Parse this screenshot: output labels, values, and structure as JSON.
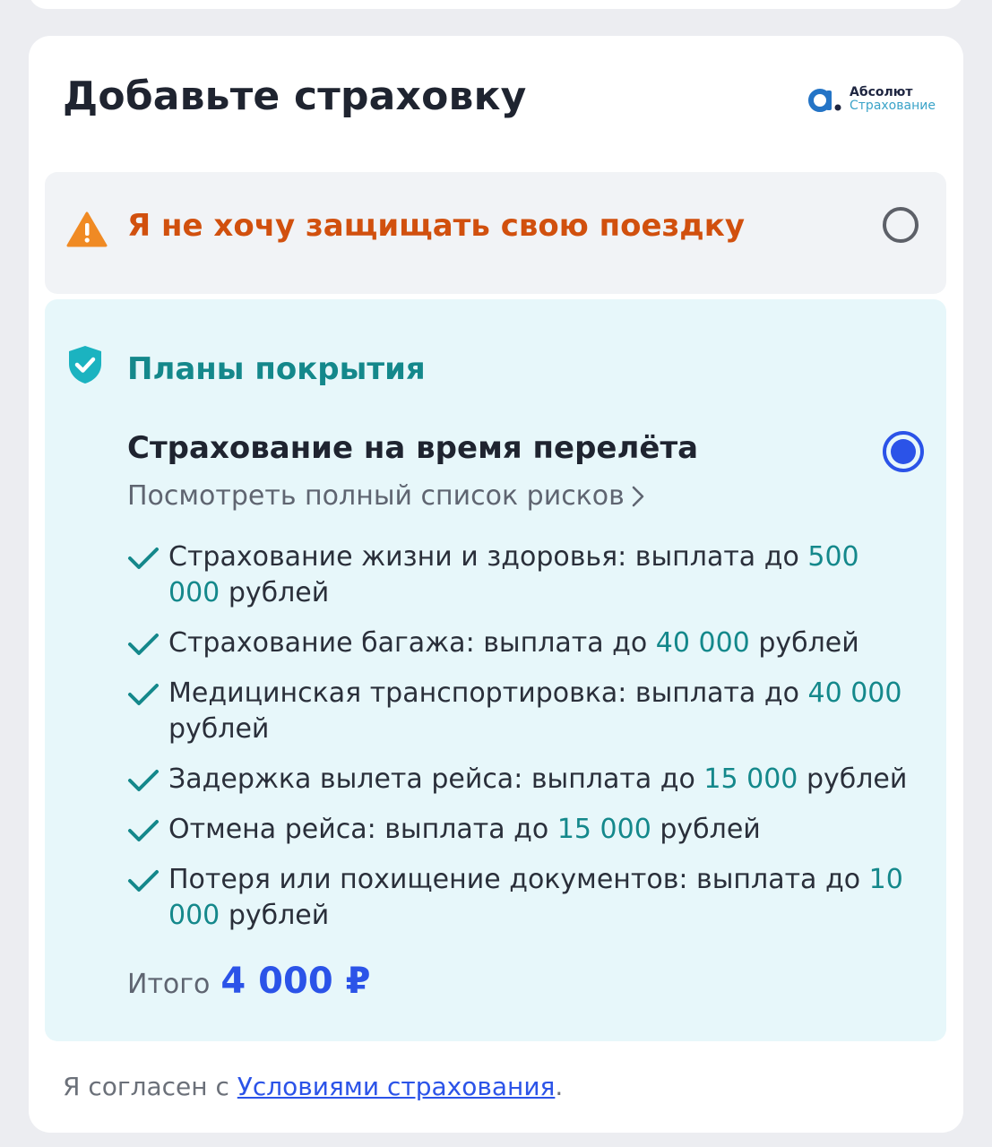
{
  "header": {
    "title": "Добавьте страховку",
    "brand": {
      "name": "Абсолют",
      "sub": "Страхование"
    }
  },
  "decline_option": {
    "label": "Я не хочу защищать свою поездку",
    "icon": "warning-icon",
    "selected": false
  },
  "plan_option": {
    "section_title": "Планы покрытия",
    "icon": "shield-check-icon",
    "plan_name": "Страхование на время перелёта",
    "risks_link": "Посмотреть полный список рисков",
    "selected": true,
    "features": [
      {
        "text": "Страхование жизни и здоровья: выплата до ",
        "amount": "500 000",
        "unit": "рублей"
      },
      {
        "text": "Страхование багажа: выплата до ",
        "amount": "40 000",
        "unit": "рублей"
      },
      {
        "text": "Медицинская транспортировка: выплата до ",
        "amount": "40 000",
        "unit": "рублей"
      },
      {
        "text": "Задержка вылета рейса: выплата до ",
        "amount": "15 000",
        "unit": "рублей"
      },
      {
        "text": "Отмена рейса: выплата до ",
        "amount": "15 000",
        "unit": "рублей"
      },
      {
        "text": "Потеря или похищение документов: выплата до ",
        "amount": "10 000",
        "unit": "рублей"
      }
    ],
    "total_label": "Итого",
    "total_value": "4 000 ₽"
  },
  "agreement": {
    "prefix": "Я согласен с ",
    "link": "Условиями страхования",
    "suffix": "."
  },
  "colors": {
    "accent_blue": "#2b53e8",
    "teal": "#14888b",
    "warning_orange": "#d1500e",
    "plan_bg": "#e7f7fa"
  }
}
